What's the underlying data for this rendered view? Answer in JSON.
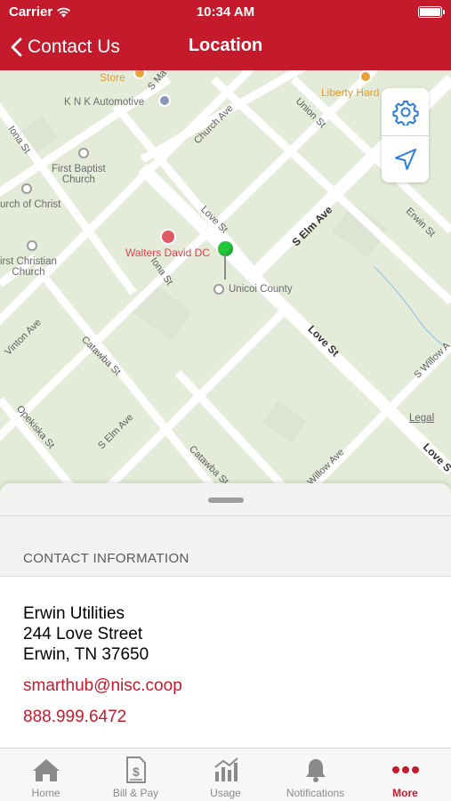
{
  "status_bar": {
    "carrier": "Carrier",
    "time": "10:34 AM"
  },
  "nav": {
    "back_label": "Contact Us",
    "title": "Location"
  },
  "map": {
    "labels": {
      "store": "Store",
      "knk": "K N K Automotive",
      "liberty": "Liberty Hard",
      "first_baptist": "First Baptist\nChurch",
      "church_of_christ": "urch of Christ",
      "first_christian": "irst Christian\nChurch",
      "walters": "Walters David DC",
      "unicoi": "Unicoi County",
      "s_elm_ave_1": "S Elm Ave",
      "s_elm_ave_2": "S Elm Ave",
      "love_st_1": "Love St",
      "love_st_2": "Love St",
      "love_st_3": "Love S",
      "iona_st_1": "Iona St",
      "iona_st_2": "Iona St",
      "church_ave": "Church Ave",
      "union_st": "Union St",
      "erwin_st": "Erwin St",
      "s_main": "S Ma",
      "vinton_ave": "Vinton Ave",
      "catawba_st_1": "Catawba St",
      "catawba_st_2": "Catawba St",
      "opekiska_st": "Opekiska St",
      "s_willow_1": "S Willow A",
      "s_willow_2": "Willow Ave",
      "legal": "Legal"
    },
    "controls": {
      "settings_icon": "gear-icon",
      "location_icon": "location-arrow-icon"
    },
    "pin_color": "#22c93a"
  },
  "contact": {
    "section_header": "CONTACT INFORMATION",
    "name": "Erwin Utilities",
    "street": "244 Love Street",
    "city": "Erwin, TN 37650",
    "email": "smarthub@nisc.coop",
    "phone": "888.999.6472"
  },
  "tabs": [
    {
      "label": "Home",
      "icon": "house-icon"
    },
    {
      "label": "Bill & Pay",
      "icon": "bill-icon"
    },
    {
      "label": "Usage",
      "icon": "usage-chart-icon"
    },
    {
      "label": "Notifications",
      "icon": "bell-icon"
    },
    {
      "label": "More",
      "icon": "more-dots-icon",
      "active": true
    }
  ],
  "colors": {
    "brand": "#c41a2c",
    "map_bg": "#e4ecd9",
    "tab_inactive": "#8a8a8a"
  }
}
